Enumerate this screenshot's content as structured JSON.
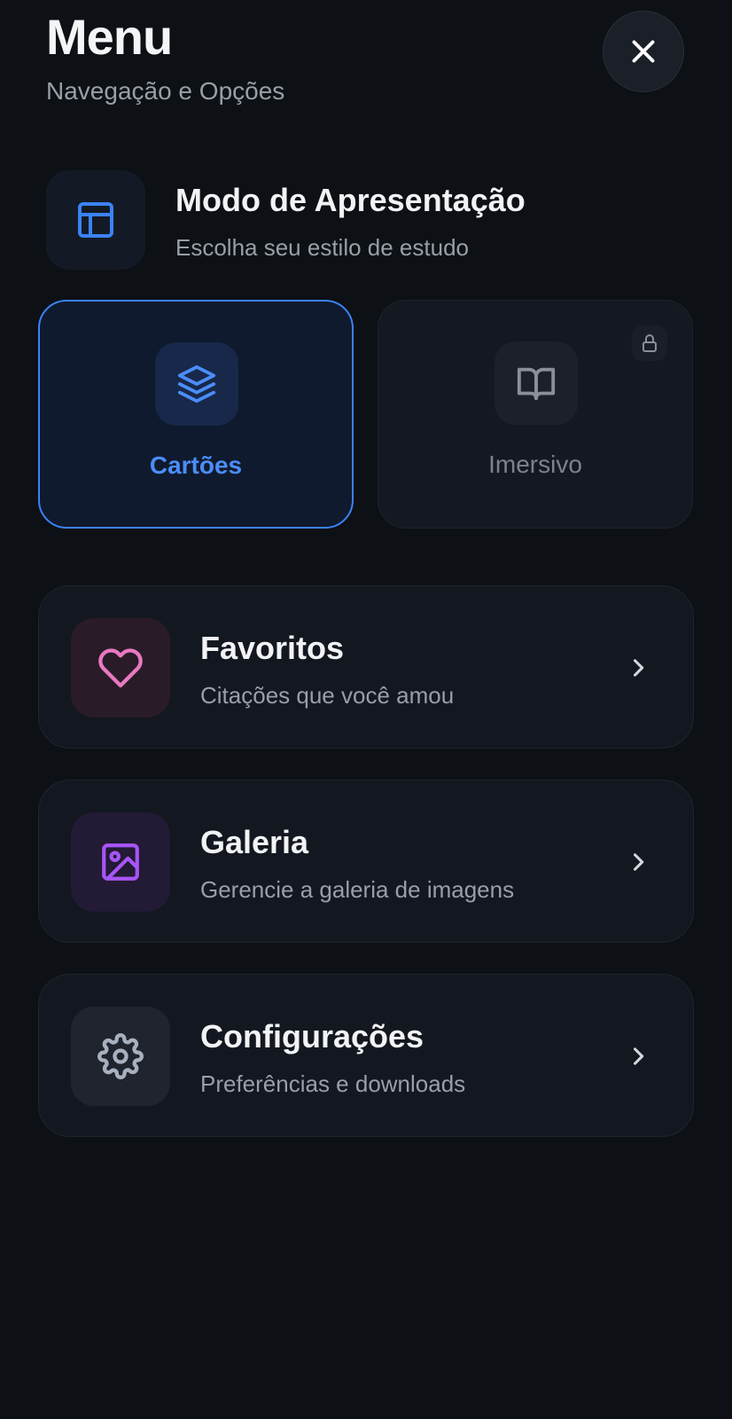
{
  "header": {
    "title": "Menu",
    "subtitle": "Navegação e Opções",
    "close_icon": "close-icon"
  },
  "presentation_mode": {
    "icon": "layout-icon",
    "title": "Modo de Apresentação",
    "subtitle": "Escolha seu estilo de estudo",
    "options": [
      {
        "label": "Cartões",
        "icon": "layers-icon",
        "selected": true,
        "locked": false
      },
      {
        "label": "Imersivo",
        "icon": "book-open-icon",
        "selected": false,
        "locked": true
      }
    ]
  },
  "menu_items": [
    {
      "title": "Favoritos",
      "subtitle": "Citações que você amou",
      "icon": "heart-icon",
      "accent": "#e879c0",
      "icon_bg": "#2a1b28"
    },
    {
      "title": "Galeria",
      "subtitle": "Gerencie a galeria de imagens",
      "icon": "image-icon",
      "accent": "#a855f7",
      "icon_bg": "#231a35"
    },
    {
      "title": "Configurações",
      "subtitle": "Preferências e downloads",
      "icon": "gear-icon",
      "accent": "#a7b0bf",
      "icon_bg": "#1f242d"
    }
  ],
  "colors": {
    "background": "#0d1015",
    "accent": "#3b82f6",
    "card": "#131720"
  }
}
